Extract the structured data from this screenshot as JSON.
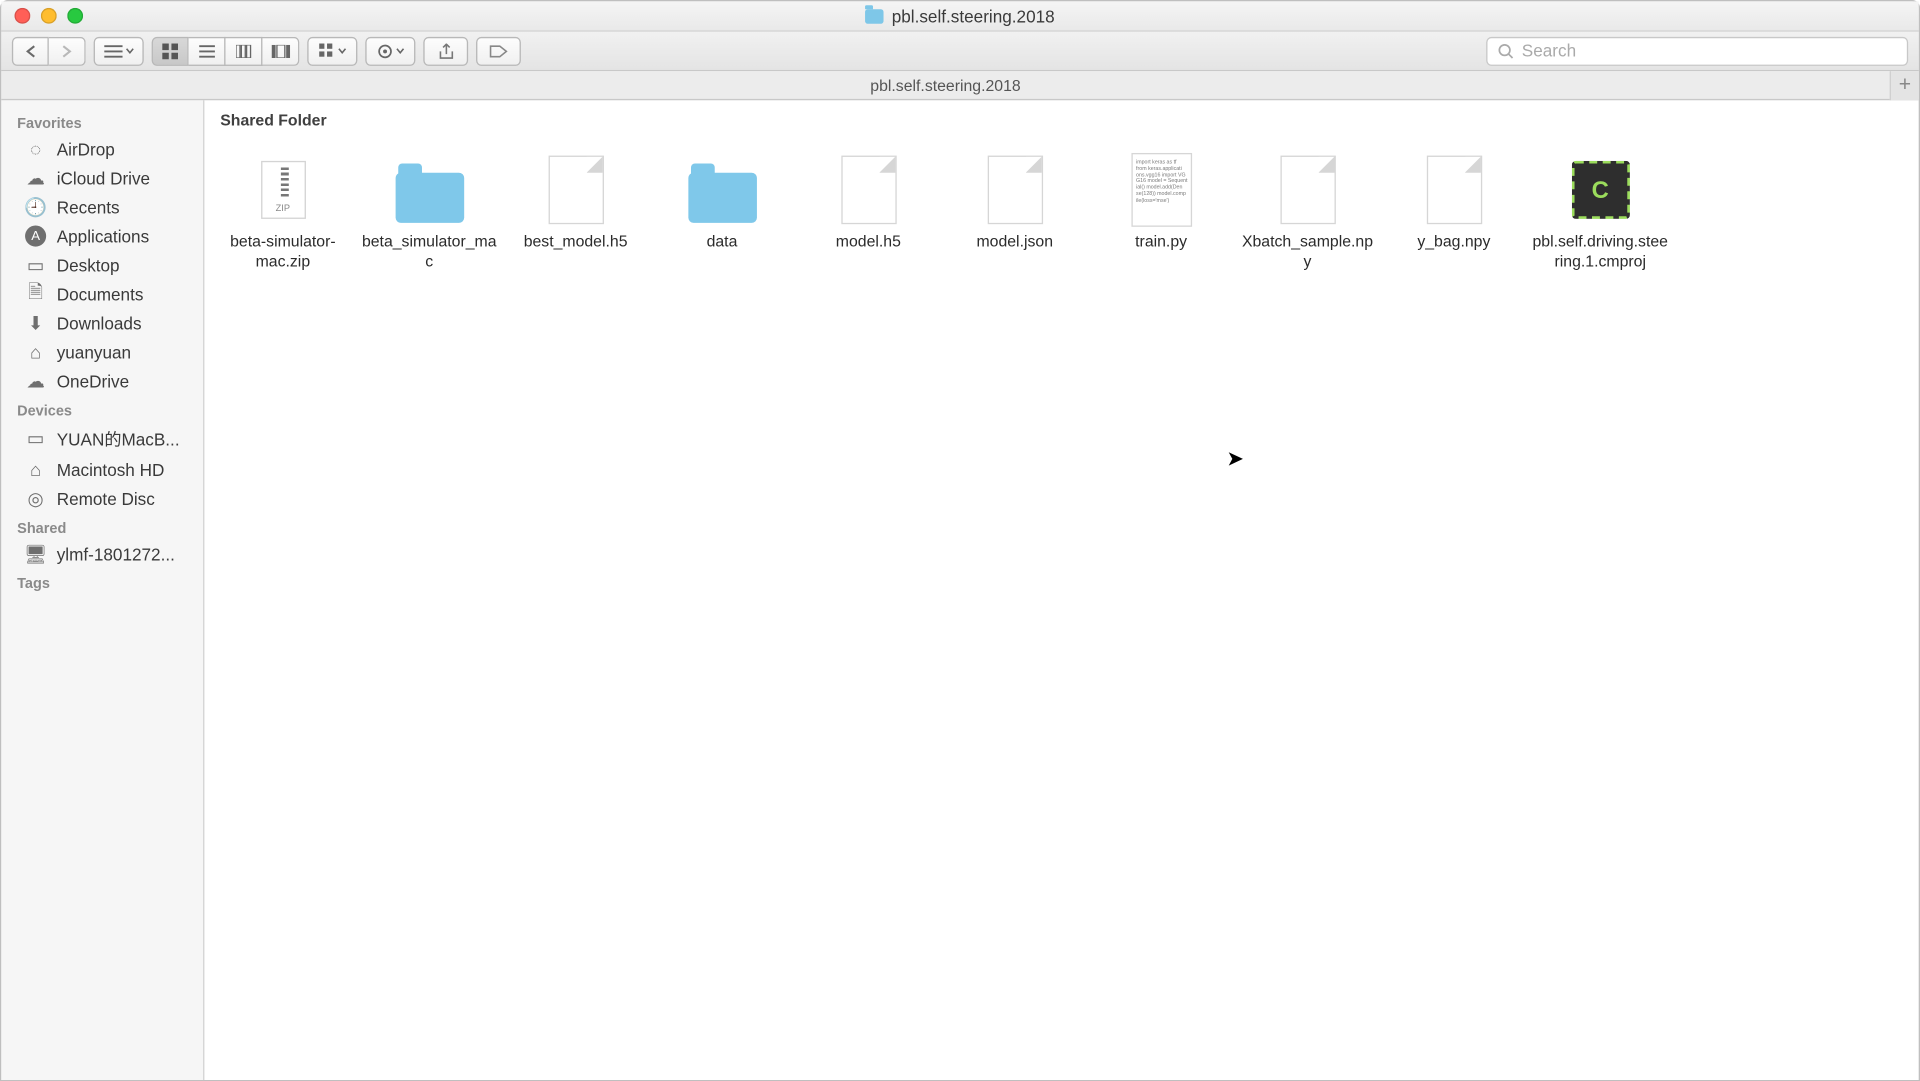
{
  "window": {
    "title": "pbl.self.steering.2018",
    "tab_title": "pbl.self.steering.2018"
  },
  "toolbar": {
    "search_placeholder": "Search"
  },
  "sidebar": {
    "sections": [
      {
        "header": "Favorites",
        "items": [
          {
            "icon": "airdrop",
            "label": "AirDrop"
          },
          {
            "icon": "icloud",
            "label": "iCloud Drive"
          },
          {
            "icon": "recents",
            "label": "Recents"
          },
          {
            "icon": "apps",
            "label": "Applications"
          },
          {
            "icon": "desktop",
            "label": "Desktop"
          },
          {
            "icon": "docs",
            "label": "Documents"
          },
          {
            "icon": "downloads",
            "label": "Downloads"
          },
          {
            "icon": "home",
            "label": "yuanyuan"
          },
          {
            "icon": "onedrive",
            "label": "OneDrive"
          }
        ]
      },
      {
        "header": "Devices",
        "items": [
          {
            "icon": "laptop",
            "label": "YUAN的MacB..."
          },
          {
            "icon": "hdd",
            "label": "Macintosh HD"
          },
          {
            "icon": "disc",
            "label": "Remote Disc"
          }
        ]
      },
      {
        "header": "Shared",
        "items": [
          {
            "icon": "pc",
            "label": "ylmf-1801272..."
          }
        ]
      },
      {
        "header": "Tags",
        "items": []
      }
    ]
  },
  "content": {
    "section": "Shared Folder",
    "items": [
      {
        "type": "zip",
        "name": "beta-simulator-mac.zip"
      },
      {
        "type": "folder",
        "name": "beta_simulator_mac"
      },
      {
        "type": "doc",
        "name": "best_model.h5"
      },
      {
        "type": "folder",
        "name": "data"
      },
      {
        "type": "doc",
        "name": "model.h5"
      },
      {
        "type": "doc",
        "name": "model.json"
      },
      {
        "type": "code",
        "name": "train.py"
      },
      {
        "type": "doc",
        "name": "Xbatch_sample.npy"
      },
      {
        "type": "doc",
        "name": "y_bag.npy"
      },
      {
        "type": "cmproj",
        "name": "pbl.self.driving.steering.1.cmproj"
      }
    ]
  }
}
